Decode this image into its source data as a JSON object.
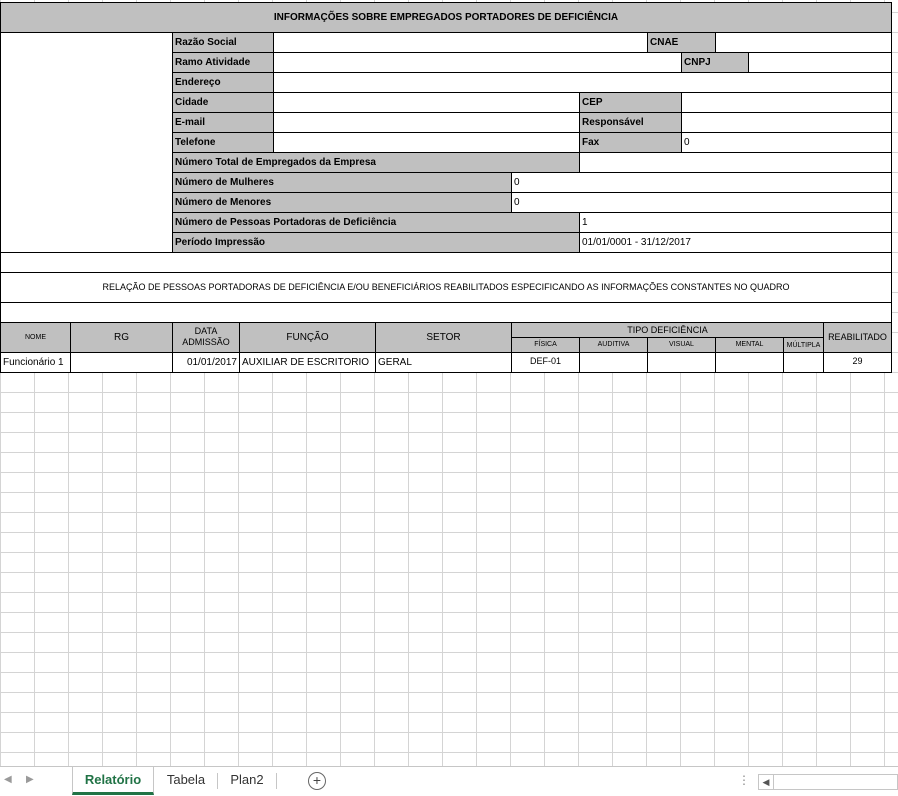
{
  "report": {
    "title": "INFORMAÇÕES SOBRE EMPREGADOS PORTADORES DE DEFICIÊNCIA",
    "company": {
      "razao_social_label": "Razão Social",
      "razao_social_value": "",
      "cnae_label": "CNAE",
      "cnae_value": "",
      "ramo_label": "Ramo Atividade",
      "ramo_value": "",
      "cnpj_label": "CNPJ",
      "cnpj_value": "",
      "endereco_label": "Endereço",
      "endereco_value": "",
      "cidade_label": "Cidade",
      "cidade_value": "",
      "cep_label": "CEP",
      "cep_value": "",
      "email_label": "E-mail",
      "email_value": "",
      "responsavel_label": "Responsável",
      "responsavel_value": "",
      "telefone_label": "Telefone",
      "telefone_value": "",
      "fax_label": "Fax",
      "fax_value": "0"
    },
    "counts": {
      "total_label": "Número Total de Empregados da Empresa",
      "total_value": "",
      "mulheres_label": "Número de Mulheres",
      "mulheres_value": "0",
      "menores_label": "Número de Menores",
      "menores_value": "0",
      "pcd_label": "Número de Pessoas Portadoras de Deficiência",
      "pcd_value": "1",
      "periodo_label": "Período Impressão",
      "periodo_value": "01/01/0001 - 31/12/2017"
    },
    "relation_text": "RELAÇÃO DE PESSOAS PORTADORAS DE DEFICIÊNCIA E/OU BENEFICIÁRIOS REABILITADOS ESPECIFICANDO AS INFORMAÇÕES CONSTANTES NO QUADRO",
    "table": {
      "headers": {
        "nome": "NOME",
        "rg": "RG",
        "data_admissao": "DATA ADMISSÃO",
        "funcao": "FUNÇÃO",
        "setor": "SETOR",
        "tipo_deficiencia": "TIPO DEFICIÊNCIA",
        "fisica": "FÍSICA",
        "auditiva": "AUDITIVA",
        "visual": "VISUAL",
        "mental": "MENTAL",
        "multipla": "MÚLTIPLA",
        "reabilitado": "REABILITADO"
      },
      "rows": [
        {
          "nome": "Funcionário 1",
          "rg": "",
          "data_admissao": "01/01/2017",
          "funcao": "AUXILIAR DE ESCRITORIO",
          "setor": "GERAL",
          "fisica": "DEF-01",
          "auditiva": "",
          "visual": "",
          "mental": "",
          "multipla": "",
          "reabilitado": "29"
        }
      ]
    }
  },
  "tabs": [
    {
      "label": "Relatório",
      "active": true
    },
    {
      "label": "Tabela",
      "active": false
    },
    {
      "label": "Plan2",
      "active": false
    }
  ],
  "icons": {
    "prev": "chevron-left-icon",
    "next": "chevron-right-icon",
    "add": "plus-circle-icon",
    "scroll_left": "scroll-left-icon"
  },
  "colors": {
    "header_fill": "#c0c0c0",
    "active_tab": "#217346",
    "grid": "#d4d4d4"
  }
}
